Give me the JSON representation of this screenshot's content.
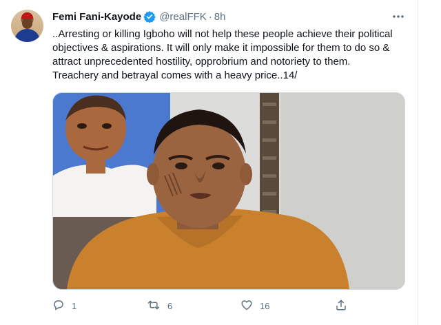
{
  "tweet": {
    "author_name": "Femi Fani-Kayode",
    "handle": "@realFFK",
    "separator": "·",
    "timestamp": "8h",
    "verified_icon": "verified-badge-icon",
    "more_icon": "more-horizontal-icon",
    "text_lines": [
      "..Arresting or killing Igboho will not help these people achieve their political",
      "objectives & aspirations. It will only make it impossible for them to do so &",
      "attract unprecedented hostility, opprobrium and notoriety to them.",
      "Treachery and betrayal comes with a heavy price..14/"
    ]
  },
  "actions": {
    "reply": {
      "icon": "reply-icon",
      "count": "1"
    },
    "retweet": {
      "icon": "retweet-icon",
      "count": "6"
    },
    "like": {
      "icon": "heart-icon",
      "count": "16"
    },
    "share": {
      "icon": "share-icon"
    }
  },
  "colors": {
    "text": "#0f1419",
    "secondary": "#5b7083",
    "verified": "#1d9bf0",
    "shirt": "#c9812d",
    "background_poster": "#3f6fcb"
  }
}
